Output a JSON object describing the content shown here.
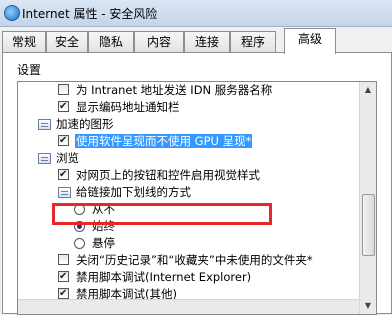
{
  "window": {
    "title": "Internet 属性 - 安全风险"
  },
  "tabs": [
    {
      "label": "常规"
    },
    {
      "label": "安全"
    },
    {
      "label": "隐私"
    },
    {
      "label": "内容"
    },
    {
      "label": "连接"
    },
    {
      "label": "程序"
    },
    {
      "label": "高级"
    }
  ],
  "active_tab": "高级",
  "settings": {
    "label": "设置",
    "items": [
      {
        "type": "checkbox",
        "checked": false,
        "text": "为 Intranet 地址发送 IDN 服务器名称"
      },
      {
        "type": "checkbox",
        "checked": true,
        "text": "显示编码地址通知栏"
      },
      {
        "type": "group",
        "icon": "group-settings-icon",
        "text": "加速的图形"
      },
      {
        "type": "checkbox",
        "checked": true,
        "text": "使用软件呈现而不使用 GPU 呈现*"
      },
      {
        "type": "group",
        "icon": "group-settings-icon",
        "text": "浏览"
      },
      {
        "type": "checkbox",
        "checked": true,
        "text": "对网页上的按钮和控件启用视觉样式"
      },
      {
        "type": "group",
        "icon": "group-settings-icon",
        "text": "给链接加下划线的方式"
      },
      {
        "type": "radio",
        "checked": false,
        "text": "从不"
      },
      {
        "type": "radio",
        "checked": true,
        "text": "始终"
      },
      {
        "type": "radio",
        "checked": false,
        "text": "悬停"
      },
      {
        "type": "checkbox",
        "checked": false,
        "text": "关闭“历史记录”和“收藏夹”中未使用的文件夹*"
      },
      {
        "type": "checkbox",
        "checked": true,
        "text": "禁用脚本调试(Internet Explorer)"
      },
      {
        "type": "checkbox",
        "checked": true,
        "text": "禁用脚本调试(其他)"
      }
    ]
  },
  "colors": {
    "highlight": "#e8262a",
    "selection": "#3399ff"
  }
}
